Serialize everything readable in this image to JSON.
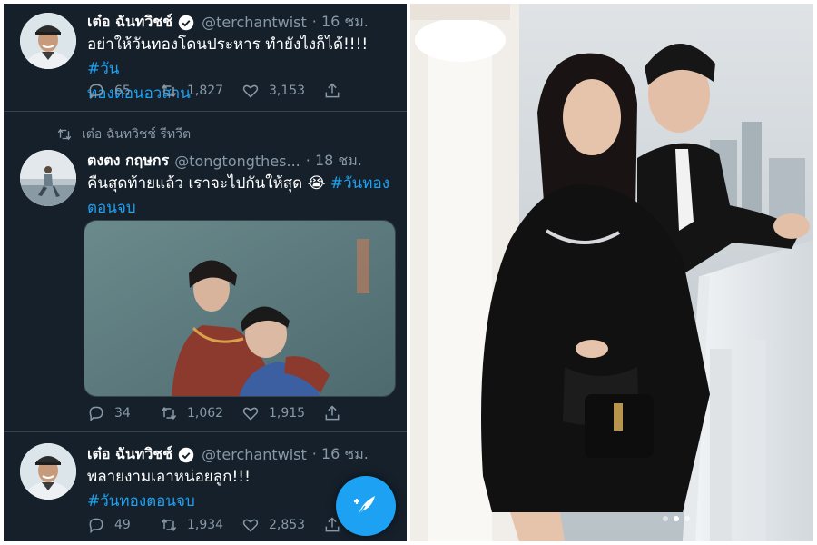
{
  "tweets": [
    {
      "name": "เต๋อ ฉันทวิชช์",
      "handle": "@terchantwist",
      "time": "· 16 ชม.",
      "text": "อย่าให้วันทองโดนประหาร ทำยังไงก็ได้!!!!",
      "hashtag_1": "#วัน",
      "hashtag_2": "ทองตอนอวสาน",
      "replies": "65",
      "retweets": "1,827",
      "likes": "3,153"
    },
    {
      "retweet_label": "เต๋อ ฉันทวิชช์ รีทวีต",
      "name": "ตงตง กฤษกร",
      "handle": "@tongtongthes...",
      "time": "· 18 ชม.",
      "text_1": "คืนสุดท้ายแล้ว เราจะไปกันให้สุด 😭",
      "hashtag_1": "#วันทอง",
      "hashtag_2": "ตอนจบ",
      "replies": "34",
      "retweets": "1,062",
      "likes": "1,915"
    },
    {
      "name": "เต๋อ ฉันทวิชช์",
      "handle": "@terchantwist",
      "time": "· 16 ชม.",
      "text": "พลายงามเอาหน่อยลูก!!!",
      "hashtag": "#วันทองตอนจบ",
      "replies": "49",
      "retweets": "1,934",
      "likes": "2,853"
    }
  ],
  "colors": {
    "background": "#15202b",
    "accent": "#1da1f2",
    "muted": "#8899a6"
  },
  "icons": [
    "reply-icon",
    "retweet-icon",
    "like-icon",
    "share-icon",
    "verified-icon",
    "compose-icon"
  ],
  "carousel": {
    "pages": 3,
    "active": 2
  }
}
